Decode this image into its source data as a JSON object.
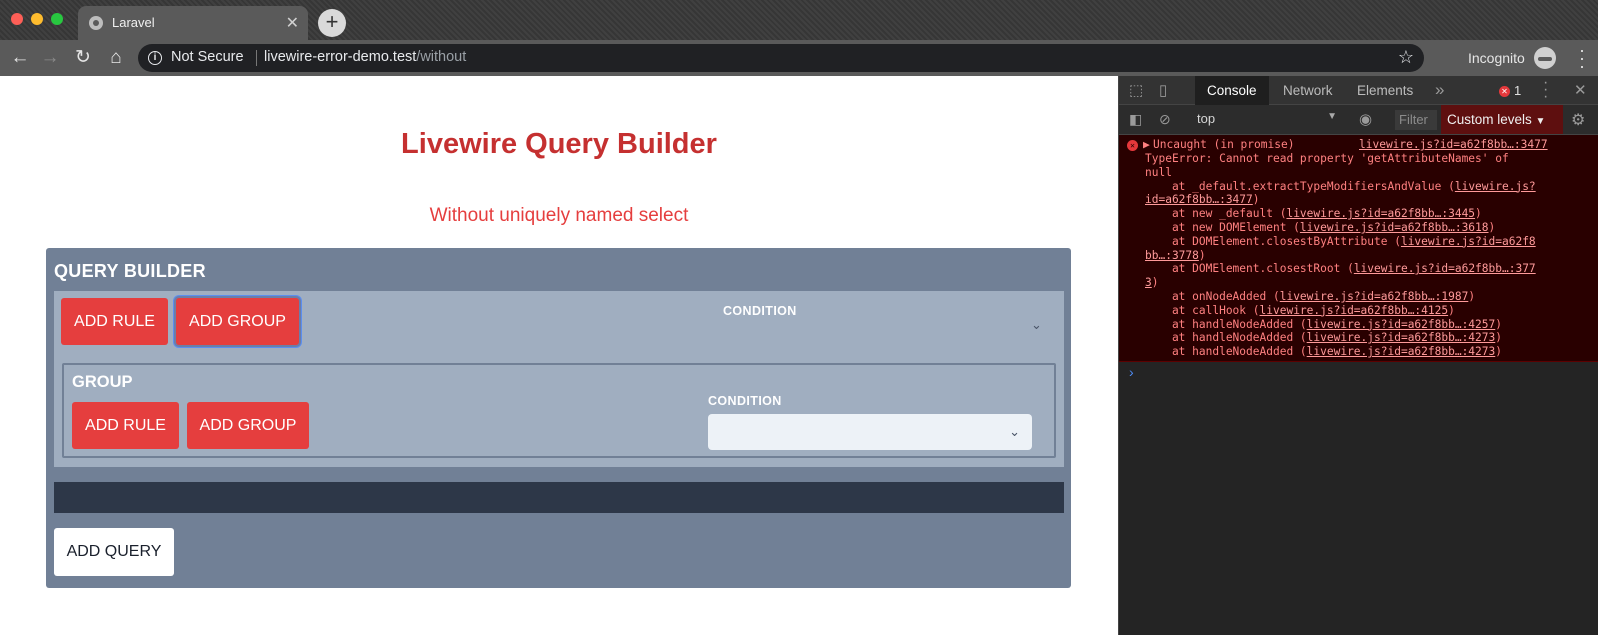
{
  "browser": {
    "tab_title": "Laravel",
    "tab_close": "✕",
    "new_tab": "+",
    "security_label": "Not Secure",
    "url_host": "livewire-error-demo.test",
    "url_path": "/without",
    "incognito_label": "Incognito"
  },
  "page": {
    "title": "Livewire Query Builder",
    "subtitle": "Without uniquely named select",
    "qb_title": "QUERY BUILDER",
    "root": {
      "add_rule": "ADD RULE",
      "add_group": "ADD GROUP",
      "condition_label": "CONDITION"
    },
    "group": {
      "title": "GROUP",
      "add_rule": "ADD RULE",
      "add_group": "ADD GROUP",
      "condition_label": "CONDITION",
      "condition_value": ""
    },
    "add_query": "ADD QUERY"
  },
  "devtools": {
    "tabs": [
      "Console",
      "Network",
      "Elements"
    ],
    "more_tabs": "»",
    "error_count": "1",
    "context": "top",
    "filter_placeholder": "Filter",
    "levels": "Custom levels",
    "error": {
      "head": "Uncaught (in promise)",
      "head_link": "livewire.js?id=a62f8bb…:3477",
      "lines": [
        "TypeError: Cannot read property 'getAttributeNames' of",
        "null",
        "    at _default.extractTypeModifiersAndValue (livewire.js?",
        "id=a62f8bb…:3477)",
        "    at new _default (livewire.js?id=a62f8bb…:3445)",
        "    at new DOMElement (livewire.js?id=a62f8bb…:3618)",
        "    at DOMElement.closestByAttribute (livewire.js?id=a62f8",
        "bb…:3778)",
        "    at DOMElement.closestRoot (livewire.js?id=a62f8bb…:377",
        "3)",
        "    at onNodeAdded (livewire.js?id=a62f8bb…:1987)",
        "    at callHook (livewire.js?id=a62f8bb…:4125)",
        "    at handleNodeAdded (livewire.js?id=a62f8bb…:4257)",
        "    at handleNodeAdded (livewire.js?id=a62f8bb…:4273)",
        "    at handleNodeAdded (livewire.js?id=a62f8bb…:4273)"
      ]
    },
    "prompt": "›"
  },
  "colors": {
    "title_red": "#c53030",
    "button_red": "#e53e3e",
    "panel_slate": "#718096",
    "group_gray": "#a0aec0",
    "console_error_bg": "#290000"
  }
}
